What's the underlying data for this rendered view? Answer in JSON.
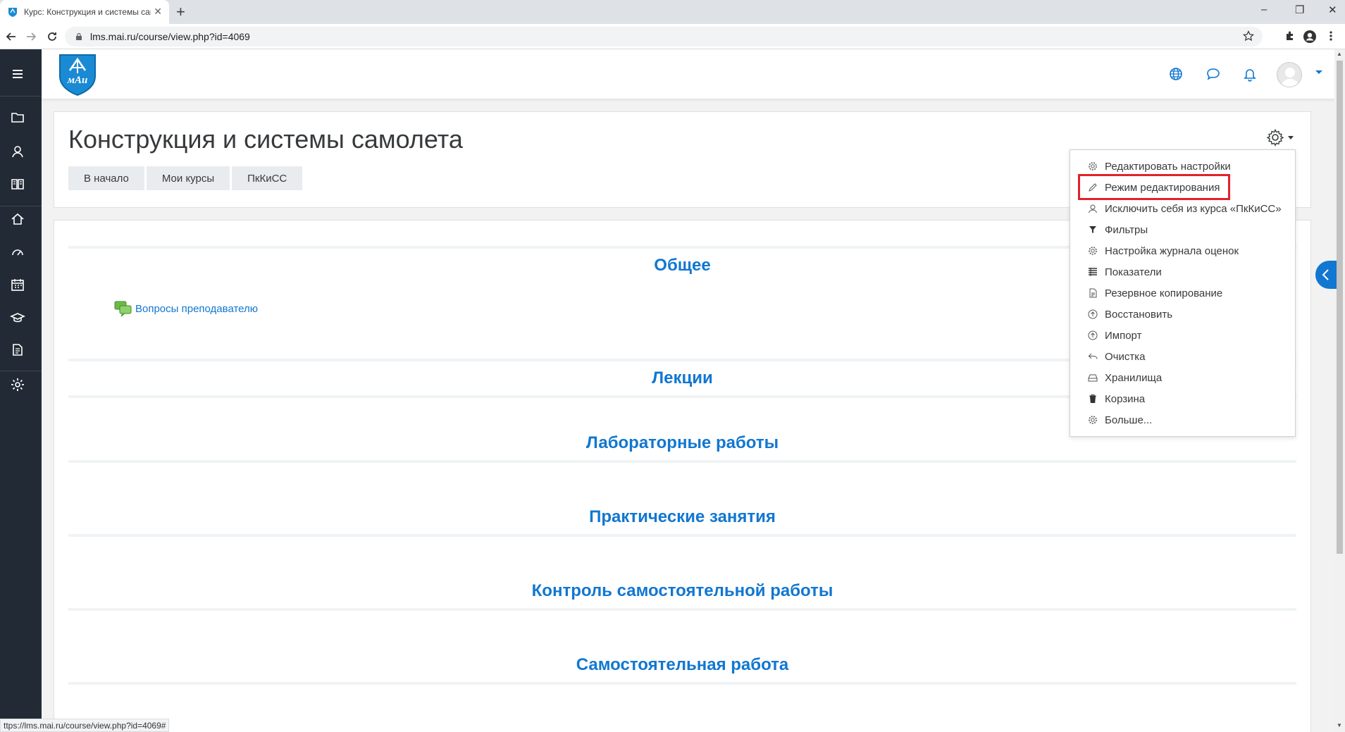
{
  "browser": {
    "tab_title": "Курс: Конструкция и системы самолета",
    "new_tab": "+",
    "close_tab": "✕",
    "url": "lms.mai.ru/course/view.php?id=4069",
    "win_minimize": "–",
    "win_restore": "❐",
    "win_close": "✕"
  },
  "header": {
    "title": "Конструкция и системы самолета",
    "breadcrumbs": [
      "В начало",
      "Мои курсы",
      "ПкКиСС"
    ]
  },
  "sections": [
    {
      "name": "Общее"
    },
    {
      "name": "Лекции"
    },
    {
      "name": "Лабораторные работы"
    },
    {
      "name": "Практические занятия"
    },
    {
      "name": "Контроль самостоятельной работы"
    },
    {
      "name": "Самостоятельная работа"
    }
  ],
  "activity": {
    "label": "Вопросы преподавателю"
  },
  "course_menu": {
    "items": [
      {
        "label": "Редактировать настройки",
        "icon": "gear-icon"
      },
      {
        "label": "Режим редактирования",
        "icon": "pencil-icon"
      },
      {
        "label": "Исключить себя из курса «ПкКиСС»",
        "icon": "user-icon"
      },
      {
        "label": "Фильтры",
        "icon": "filter-icon"
      },
      {
        "label": "Настройка журнала оценок",
        "icon": "gear-icon"
      },
      {
        "label": "Показатели",
        "icon": "table-icon"
      },
      {
        "label": "Резервное копирование",
        "icon": "file-icon"
      },
      {
        "label": "Восстановить",
        "icon": "upload-icon"
      },
      {
        "label": "Импорт",
        "icon": "upload-icon"
      },
      {
        "label": "Очистка",
        "icon": "undo-icon"
      },
      {
        "label": "Хранилища",
        "icon": "drive-icon"
      },
      {
        "label": "Корзина",
        "icon": "trash-icon"
      },
      {
        "label": "Больше...",
        "icon": "gear-icon"
      }
    ],
    "highlighted_index": 1
  },
  "status_url": "ttps://lms.mai.ru/course/view.php?id=4069#",
  "colors": {
    "accent": "#1177d1",
    "drawer": "#222b35",
    "highlight": "#e5202a"
  }
}
